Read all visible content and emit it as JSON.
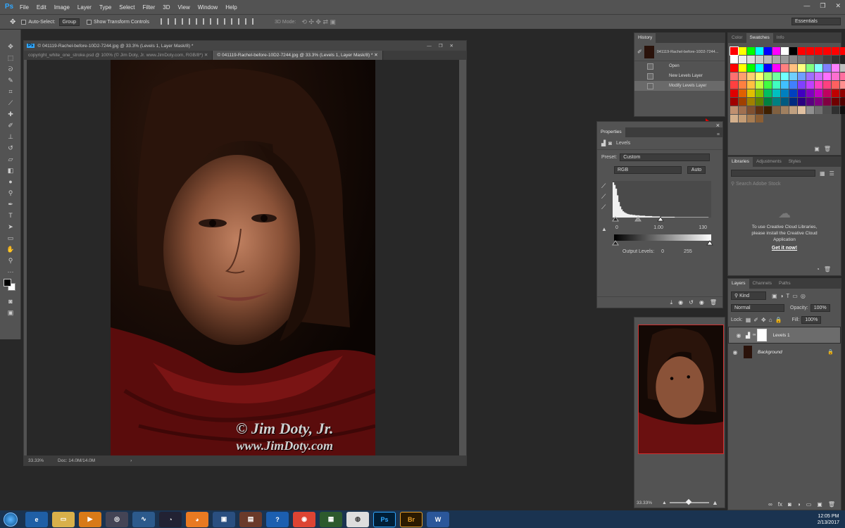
{
  "app": {
    "logo": "Ps",
    "workspace": "Essentials"
  },
  "menu": [
    "File",
    "Edit",
    "Image",
    "Layer",
    "Type",
    "Select",
    "Filter",
    "3D",
    "View",
    "Window",
    "Help"
  ],
  "window_controls": [
    "—",
    "❐",
    "✕"
  ],
  "options": {
    "auto_select_label": "Auto-Select:",
    "auto_select_value": "Group",
    "transform_label": "Show Transform Controls",
    "mode_3d": "3D Mode:"
  },
  "document": {
    "window_title": "© 041119-Rachel-before-10D2-7244.jpg @ 33.3% (Levels 1, Layer Mask/8) *",
    "tabs": [
      {
        "label": "copyright_white_one_stroke.psd @ 100% (© Jim Doty, Jr. www.JimDoty.com, RGB/8*)"
      },
      {
        "label": "© 041119-Rachel-before-10D2-7244.jpg @ 33.3% (Levels 1, Layer Mask/8) *"
      }
    ],
    "watermark_line1": "© Jim Doty, Jr.",
    "watermark_line2": "www.JimDoty.com",
    "zoom": "33.33%",
    "doc_size": "Doc: 14.0M/14.0M"
  },
  "history": {
    "tab": "History",
    "snapshot": "041119-Rachel-before-10D2-7244...",
    "items": [
      {
        "label": "Open"
      },
      {
        "label": "New Levels Layer"
      },
      {
        "label": "Modify Levels Layer"
      }
    ]
  },
  "properties": {
    "tab": "Properties",
    "title": "Levels",
    "preset_label": "Preset:",
    "preset_value": "Custom",
    "channel": "RGB",
    "auto_button": "Auto",
    "input_black": "0",
    "input_gamma": "1.00",
    "input_white": "130",
    "output_label": "Output Levels:",
    "output_black": "0",
    "output_white": "255"
  },
  "swatches": {
    "tabs": [
      "Color",
      "Swatches",
      "Info"
    ],
    "colors": [
      "#ff0000",
      "#ffff00",
      "#00ff00",
      "#00ffff",
      "#0000ff",
      "#ff00ff",
      "#ffffff",
      "#000000",
      "#ff0000",
      "#ff0000",
      "#ff0000",
      "#ff0000",
      "#ff0000",
      "#ff0000",
      "#ffffff",
      "#eeeeee",
      "#dddddd",
      "#cccccc",
      "#bbbbbb",
      "#aaaaaa",
      "#999999",
      "#888888",
      "#777777",
      "#666666",
      "#555555",
      "#444444",
      "#333333",
      "#222222",
      "#ff0000",
      "#ffff00",
      "#00ff00",
      "#00ffff",
      "#0000ff",
      "#ff00ff",
      "#ff8080",
      "#ffc080",
      "#ffff80",
      "#80ff80",
      "#80ffff",
      "#8080ff",
      "#ff80ff",
      "#c0c0c0",
      "#ff7070",
      "#ff9f6f",
      "#ffcf6f",
      "#ffff6f",
      "#9fff6f",
      "#6fff9f",
      "#6fffff",
      "#6fcfff",
      "#6f9fff",
      "#9f6fff",
      "#cf6fff",
      "#ff6fff",
      "#ff6fcf",
      "#ff6f9f",
      "#ff4040",
      "#ff8040",
      "#ffc040",
      "#c0ff40",
      "#40ff40",
      "#40ffc0",
      "#40c0ff",
      "#4080ff",
      "#8040ff",
      "#c040ff",
      "#ff40c0",
      "#ff4080",
      "#ff6060",
      "#ff9090",
      "#e00000",
      "#e06000",
      "#e0c000",
      "#80c000",
      "#00c060",
      "#00c0c0",
      "#0080c0",
      "#0040c0",
      "#4000c0",
      "#8000c0",
      "#c000c0",
      "#c00060",
      "#c00000",
      "#900000",
      "#a00000",
      "#a04000",
      "#a08000",
      "#608000",
      "#008040",
      "#008080",
      "#005a80",
      "#002a80",
      "#2a0080",
      "#5a0080",
      "#800080",
      "#800040",
      "#700000",
      "#500000",
      "#c09070",
      "#a07050",
      "#805030",
      "#603010",
      "#402000",
      "#806040",
      "#a08060",
      "#c0a080",
      "#e0c0a0",
      "#909090",
      "#707070",
      "#505050",
      "#303030",
      "#101010",
      "#d4b08c",
      "#c49c74",
      "#a67c52",
      "#8b5e34"
    ],
    "selected_index": 0
  },
  "libraries": {
    "tabs": [
      "Libraries",
      "Adjustments",
      "Styles"
    ],
    "search_placeholder": "Search Adobe Stock",
    "message": "To use Creative Cloud Libraries, please install the Creative Cloud Application",
    "link": "Get it now!"
  },
  "layers": {
    "tabs": [
      "Layers",
      "Channels",
      "Paths"
    ],
    "filter": "Kind",
    "blend": "Normal",
    "opacity_label": "Opacity:",
    "opacity": "100%",
    "lock_label": "Lock:",
    "fill_label": "Fill:",
    "fill": "100%",
    "items": [
      {
        "name": "Levels 1"
      },
      {
        "name": "Background"
      }
    ]
  },
  "navigator": {
    "zoom": "33.33%"
  },
  "taskbar": {
    "time": "12:05 PM",
    "date": "2/13/2017"
  },
  "chart_data": {
    "type": "bar",
    "title": "",
    "histogram": [
      95,
      88,
      78,
      60,
      42,
      30,
      22,
      17,
      14,
      12,
      10,
      9,
      8,
      8,
      7,
      7,
      6,
      6,
      6,
      5,
      5,
      5,
      5,
      4,
      4,
      4,
      4,
      4,
      3,
      3,
      3,
      3,
      3,
      3,
      2,
      2,
      2,
      2,
      2,
      2,
      2,
      2,
      2,
      2,
      1,
      1,
      1,
      1,
      1,
      1,
      1,
      1,
      1,
      1,
      1,
      1,
      1,
      1,
      1,
      1,
      1,
      1,
      1,
      1,
      1,
      1,
      1,
      1,
      0,
      0
    ]
  }
}
